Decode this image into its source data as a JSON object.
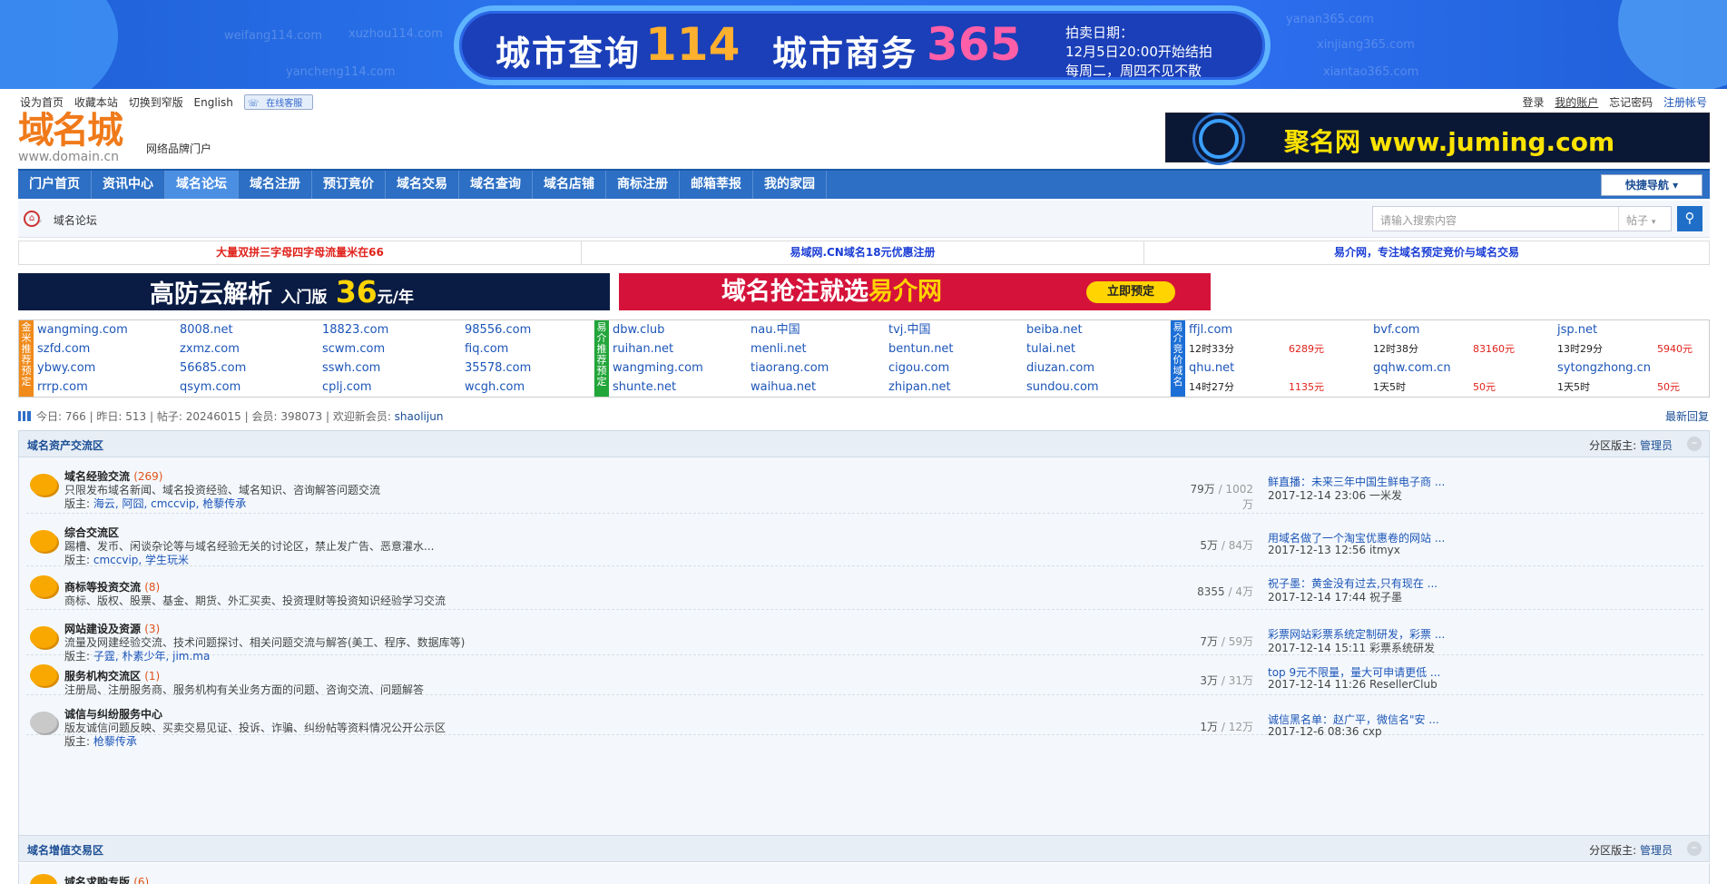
{
  "banner": {
    "ghosts": [
      "weifang114.com",
      "xuzhou114.com",
      "yancheng114.com",
      "yanan365.com",
      "xinjiang365.com",
      "xiantao365.com"
    ],
    "left_text": "城市查询",
    "left_num": "114",
    "right_text": "城市商务",
    "right_num": "365",
    "info": [
      "拍卖日期：",
      "12月5日20:00开始结拍",
      "每周二，周四不见不散"
    ]
  },
  "toplinks": [
    "设为首页",
    "收藏本站",
    "切换到窄版",
    "English"
  ],
  "kefu": "在线客服",
  "userlinks": [
    "登录",
    "我的账户",
    "忘记密码",
    "注册帐号"
  ],
  "logo": {
    "big": "域名城",
    "url": "www.domain.cn"
  },
  "slogan": "网络品牌门户",
  "ad_right": "www.juming.com",
  "ad_right_brand": "聚名网",
  "nav": {
    "items": [
      "门户首页",
      "资讯中心",
      "域名论坛",
      "域名注册",
      "预订竟价",
      "域名交易",
      "域名查询",
      "域名店铺",
      "商标注册",
      "邮箱莘报",
      "我的家园"
    ],
    "quick": "快捷导航 ▾"
  },
  "crumb": "域名论坛",
  "search": {
    "placeholder": "请输入搜索内容",
    "type": "帖子"
  },
  "notices": [
    "大量双拼三字母四字母流量米在66",
    "易域网.CN域名18元优惠注册",
    "易介网，专注域名预定竞价与域名交易"
  ],
  "ad1": {
    "main": "高防云解析",
    "sub": "入门版",
    "num": "36",
    "unit": "元/年"
  },
  "ad2": {
    "main": "域名抢注就选",
    "brand": "易介网",
    "btn": "立即预定"
  },
  "domain_blocks": [
    {
      "tag": "金米推荐预定",
      "color": "#f08a1a",
      "cols": [
        [
          "wangming.com",
          "szfd.com",
          "ybwy.com",
          "rrrp.com"
        ],
        [
          "8008.net",
          "zxmz.com",
          "56685.com",
          "qsym.com"
        ],
        [
          "18823.com",
          "scwm.com",
          "sswh.com",
          "cplj.com"
        ],
        [
          "98556.com",
          "fiq.com",
          "35578.com",
          "wcgh.com"
        ]
      ]
    },
    {
      "tag": "易介推荐预定",
      "color": "#22a63a",
      "cols": [
        [
          "dbw.club",
          "ruihan.net",
          "wangming.com",
          "shunte.net"
        ],
        [
          "nau.中国",
          "menli.net",
          "tiaorang.com",
          "waihua.net"
        ],
        [
          "tvj.中国",
          "bentun.net",
          "cigou.com",
          "zhipan.net"
        ],
        [
          "beiba.net",
          "tulai.net",
          "diuzan.com",
          "sundou.com"
        ]
      ]
    },
    {
      "tag": "易介竞价域名",
      "color": "#1c6fd6",
      "rows": [
        [
          {
            "d": "ffjl.com"
          },
          {
            "d": "bvf.com"
          },
          {
            "d": "jsp.net"
          }
        ],
        [
          {
            "t": "12时33分",
            "p": "6289元"
          },
          {
            "t": "12时38分",
            "p": "83160元"
          },
          {
            "t": "13时29分",
            "p": "5940元"
          }
        ],
        [
          {
            "d": "qhu.net"
          },
          {
            "d": "gqhw.com.cn"
          },
          {
            "d": "sytongzhong.cn"
          }
        ],
        [
          {
            "t": "14时27分",
            "p": "1135元"
          },
          {
            "t": "1天5时",
            "p": "50元"
          },
          {
            "t": "1天5时",
            "p": "50元"
          }
        ]
      ]
    }
  ],
  "stats": "今日: 766 | 昨日: 513 | 帖子: 20246015 | 会员: 398073 | 欢迎新会员: ",
  "new_member": "shaolijun",
  "newest_reply": "最新回复",
  "sections": [
    {
      "title": "域名资产交流区",
      "mod_label": "分区版主: ",
      "mod": "管理员"
    },
    {
      "title": "域名增值交易区",
      "mod_label": "分区版主: ",
      "mod": "管理员"
    }
  ],
  "forums": [
    {
      "name": "域名经验交流",
      "count": "(269)",
      "desc": "只限发布域名新闻、域名投资经验、域名知识、咨询解答问题交流",
      "mods": "海云, 阿囧, cmccvip, 枪藜传承",
      "posts": "79万",
      "total": " / 1002万",
      "last": "鲜直播：未来三年中国生鲜电子商 ...",
      "when": "2017-12-14 23:06 一米发"
    },
    {
      "name": "综合交流区",
      "count": "",
      "desc": "踢槽、发币、闲谈杂论等与域名经验无关的讨论区，禁止发广告、恶意灌水...",
      "mods": "cmccvip, 学生玩米",
      "posts": "5万",
      "total": " / 84万",
      "last": "用域名做了一个淘宝优惠卷的网站 ...",
      "when": "2017-12-13 12:56 itmyx"
    },
    {
      "name": "商标等投资交流",
      "count": "(8)",
      "desc": "商标、版权、股票、基金、期货、外汇买卖、投资理财等投资知识经验学习交流",
      "mods": "",
      "posts": "8355",
      "total": " / 4万",
      "last": "祝子墨：黄金没有过去,只有现在 ...",
      "when": "2017-12-14 17:44 祝子墨"
    },
    {
      "name": "网站建设及资源",
      "count": "(3)",
      "desc": "流量及网建经验交流、技术问题探讨、相关问题交流与解答(美工、程序、数据库等)",
      "mods": "子霆, 朴素少年, jim.ma",
      "posts": "7万",
      "total": " / 59万",
      "last": "彩票网站彩票系统定制研发，彩票 ...",
      "when": "2017-12-14 15:11 彩票系统研发"
    },
    {
      "name": "服务机构交流区",
      "count": "(1)",
      "desc": "注册局、注册服务商、服务机构有关业务方面的问题、咨询交流、问题解答",
      "mods": "",
      "posts": "3万",
      "total": " / 31万",
      "last": "top 9元不限量，量大可申请更低 ...",
      "when": "2017-12-14 11:26 ResellerClub"
    },
    {
      "name": "诚信与纠纷服务中心",
      "count": "",
      "desc": "版友诚信问题反映、买卖交易见证、投诉、诈骗、纠纷帖等资料情况公开公示区",
      "mods": "枪藜传承",
      "posts": "1万",
      "total": " / 12万",
      "last": "诚信黑名单：赵广平，微信名\"安 ...",
      "when": "2017-12-6 08:36 cxp"
    }
  ],
  "mod_prefix": "版主: ",
  "next_forum": {
    "name": "域名求购专版",
    "count": "(6)"
  }
}
